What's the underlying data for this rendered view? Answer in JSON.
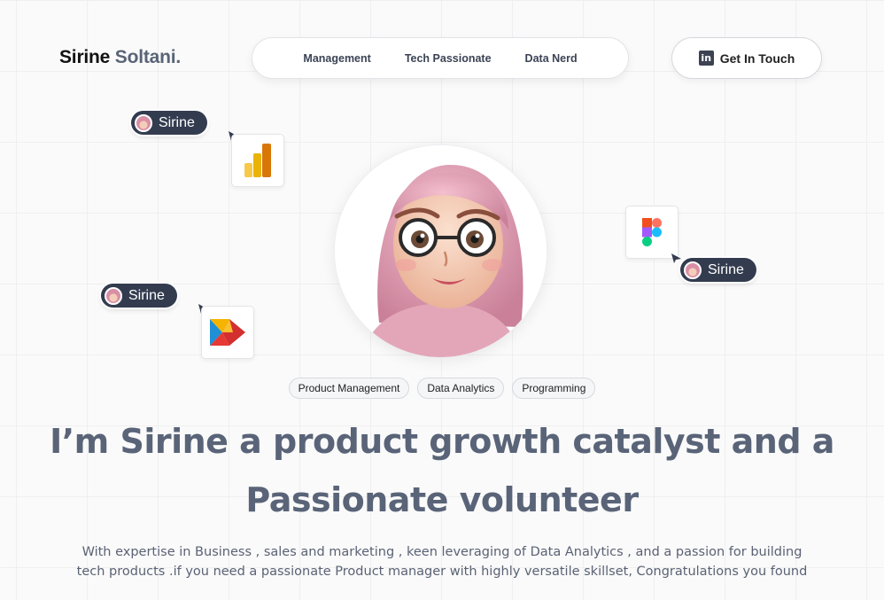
{
  "brand": {
    "first": "Sirine",
    "last": "Soltani."
  },
  "nav": {
    "items": [
      "Management",
      "Tech Passionate",
      "Data Nerd"
    ]
  },
  "cta": {
    "label": "Get In Touch",
    "icon": "linkedin-icon",
    "icon_glyph": "in"
  },
  "pills": {
    "label": "Sirine"
  },
  "tools": [
    "power-bi-icon",
    "figma-icon",
    "tableau-arrow-icon"
  ],
  "tags": [
    "Product Management",
    "Data Analytics",
    "Programming"
  ],
  "hero": {
    "headline_line1": "I’m Sirine a product growth catalyst and a",
    "headline_line2": "Passionate volunteer",
    "para_line1": "With expertise in Business , sales and marketing  , keen leveraging of Data Analytics , and a passion for building",
    "para_line2": "tech products  .if you need a passionate Product manager with highly versatile skillset, Congratulations you found"
  },
  "colors": {
    "heading": "#5a6478",
    "pill_bg": "#333c4f",
    "text_dark": "#111111",
    "brand_accent": "#5a6477"
  }
}
